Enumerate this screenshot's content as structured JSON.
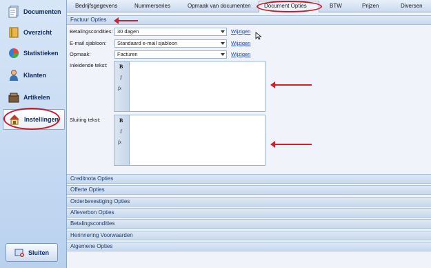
{
  "sidebar": {
    "items": [
      {
        "label": "Documenten",
        "icon": "documents-icon"
      },
      {
        "label": "Overzicht",
        "icon": "book-icon"
      },
      {
        "label": "Statistieken",
        "icon": "pie-chart-icon"
      },
      {
        "label": "Klanten",
        "icon": "user-icon"
      },
      {
        "label": "Artikelen",
        "icon": "articles-icon"
      },
      {
        "label": "Instellingen",
        "icon": "settings-house-icon"
      }
    ],
    "close_label": "Sluiten"
  },
  "tabs": [
    "Bedrijfsgegevens",
    "Nummerseries",
    "Opmaak van documenten",
    "Document Opties",
    "BTW",
    "Prijzen",
    "Diversen"
  ],
  "active_tab": "Document Opties",
  "factuur": {
    "title": "Factuur Opties",
    "betaling_label": "Betalingscondities:",
    "betaling_value": "30 dagen",
    "email_label": "E-mail sjabloon:",
    "email_value": "Standaard e-mail sjabloon",
    "opmaak_label": "Opmaak:",
    "opmaak_value": "Facturen",
    "wijzigen": "Wijzigen",
    "inleidende_label": "Inleidende tekst:",
    "sluiting_label": "Sluiting tekst:"
  },
  "editor_tools": {
    "bold": "B",
    "italic": "I",
    "fx": "fx"
  },
  "sections": [
    "Creditnota Opties",
    "Offerte Opties",
    "Orderbevestiging Opties",
    "Afleverbon Opties",
    "Betalingscondities",
    "Herinnering Voorwaarden",
    "Algemene Opties"
  ],
  "colors": {
    "accent_red": "#c9192b",
    "link": "#1a3fa8",
    "nav_text": "#0b2d66"
  }
}
